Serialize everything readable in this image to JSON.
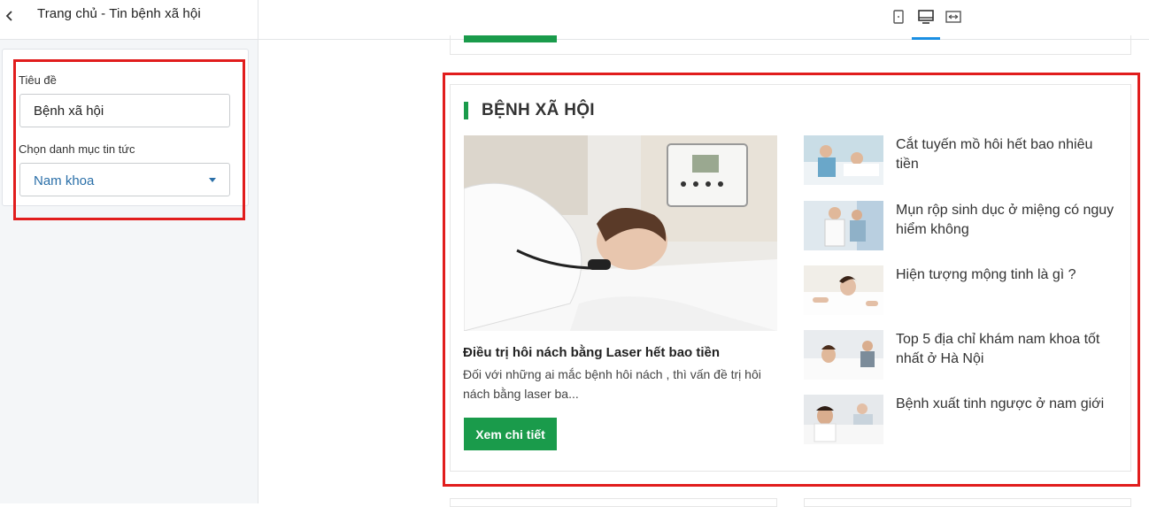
{
  "panel": {
    "title": "Trang chủ - Tin bệnh xã hội",
    "title_label": "Tiêu đề",
    "title_value": "Bệnh xã hội",
    "category_label": "Chọn danh mục tin tức",
    "category_value": "Nam khoa"
  },
  "devices": {
    "items": [
      "mobile-icon",
      "desktop-icon",
      "fullwidth-icon"
    ],
    "active": "desktop-icon"
  },
  "section": {
    "heading": "BỆNH XÃ HỘI",
    "featured": {
      "title": "Điều trị hôi nách bằng Laser hết bao tiền",
      "excerpt": "Đối với những ai mắc bệnh hôi nách , thì vấn đề trị hôi nách bằng laser ba...",
      "button": "Xem chi tiết"
    },
    "items": [
      {
        "title": "Cắt tuyến mồ hôi hết bao nhiêu tiền"
      },
      {
        "title": "Mụn rộp sinh dục ở miệng có nguy hiểm không"
      },
      {
        "title": "Hiện tượng mộng tinh là gì ?"
      },
      {
        "title": "Top 5 địa chỉ khám nam khoa tốt nhất ở Hà Nội"
      },
      {
        "title": "Bệnh xuất tinh ngược ở nam giới"
      }
    ]
  },
  "colors": {
    "accent": "#1a9b4b",
    "highlight": "#e11d1d",
    "active_tab": "#1a8fe3",
    "link": "#2a6fa8"
  }
}
